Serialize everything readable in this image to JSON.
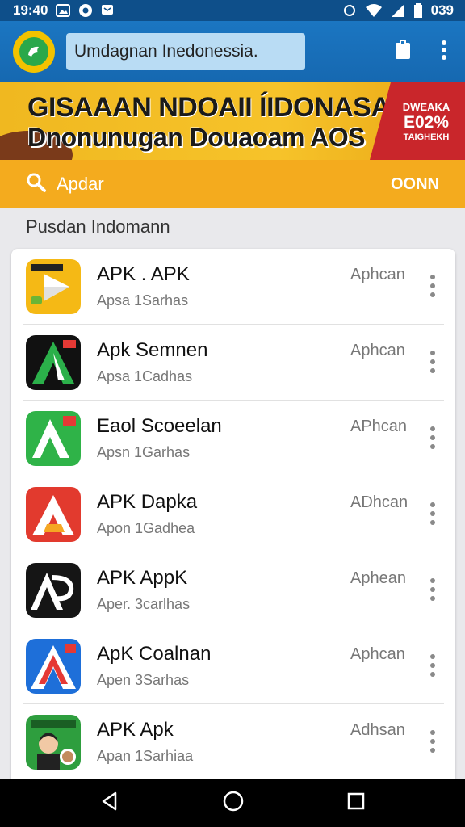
{
  "status_bar": {
    "time": "19:40",
    "battery": "039",
    "icons": [
      "gallery-icon",
      "chrome-icon",
      "message-icon",
      "sync-icon",
      "wifi-icon",
      "signal-icon",
      "battery-icon"
    ]
  },
  "app_bar": {
    "search_text": "Umdagnan Inedonessia.",
    "icons": [
      "app-logo-icon",
      "clipboard-icon",
      "overflow-menu-icon"
    ],
    "accent_color": "#1b76c2"
  },
  "banner": {
    "title": "GISAAAN NDOAII ÍIDONASAI",
    "subtitle": "Dnonunugan Douaoam AOS",
    "badge_top": "DWEAKA",
    "badge_pct": "E02%",
    "badge_bottom": "TAIGHEKH",
    "badge_color": "#c9262b"
  },
  "search_strip": {
    "placeholder": "Apdar",
    "button": "OONN",
    "color": "#f4ab1e"
  },
  "section_title": "Pusdan Indomann",
  "apps": [
    {
      "name": "APK . APK",
      "subtitle": "Apsa 1Sarhas",
      "action": "Aphcan",
      "icon": "yellow-play-icon"
    },
    {
      "name": "Apk Semnen",
      "subtitle": "Apsa 1Cadhas",
      "action": "Aphcan",
      "icon": "black-green-a-icon"
    },
    {
      "name": "Eaol Scoeelan",
      "subtitle": "Apsn 1Garhas",
      "action": "APhcan",
      "icon": "green-a-icon"
    },
    {
      "name": "APK Dapka",
      "subtitle": "Apon 1Gadhea",
      "action": "ADhcan",
      "icon": "red-a-icon"
    },
    {
      "name": "APK AppK",
      "subtitle": "Aper. 3carlhas",
      "action": "Aphean",
      "icon": "black-ap-icon"
    },
    {
      "name": "ApK Coalnan",
      "subtitle": "Apen 3Sarhas",
      "action": "Aphcan",
      "icon": "blue-red-a-icon"
    },
    {
      "name": "APK Apk",
      "subtitle": "Apan 1Sarhiaa",
      "action": "Adhsan",
      "icon": "photo-app-icon"
    }
  ],
  "nav_bar": {
    "icons": [
      "back-icon",
      "home-icon",
      "recents-icon"
    ]
  }
}
